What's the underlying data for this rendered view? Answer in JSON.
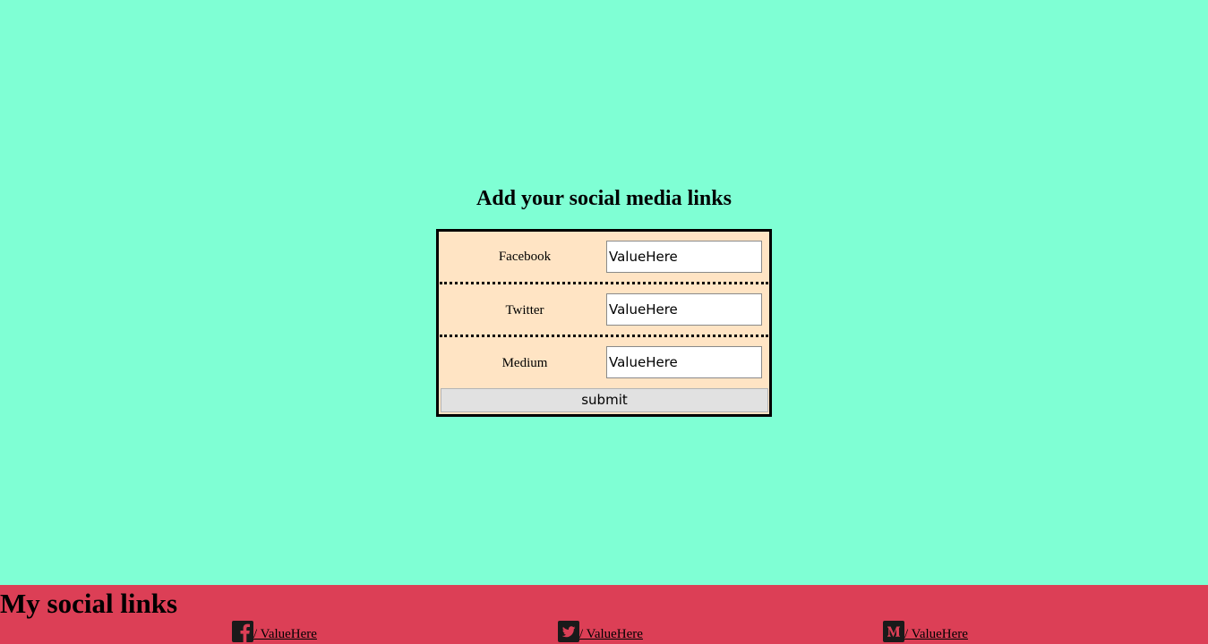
{
  "form": {
    "title": "Add your social media links",
    "rows": [
      {
        "label": "Facebook",
        "value": "ValueHere"
      },
      {
        "label": "Twitter",
        "value": "ValueHere"
      },
      {
        "label": "Medium",
        "value": "ValueHere"
      }
    ],
    "submit_label": "submit"
  },
  "footer": {
    "title": "My social links",
    "links": [
      {
        "icon": "facebook-icon",
        "text": "/ ValueHere"
      },
      {
        "icon": "twitter-icon",
        "text": "/ ValueHere"
      },
      {
        "icon": "medium-icon",
        "text": "/ ValueHere"
      }
    ]
  },
  "colors": {
    "page_background": "#7fffd4",
    "form_background": "#ffe4c4",
    "footer_background": "#dc3f56",
    "button_background": "#e1e1e1"
  }
}
